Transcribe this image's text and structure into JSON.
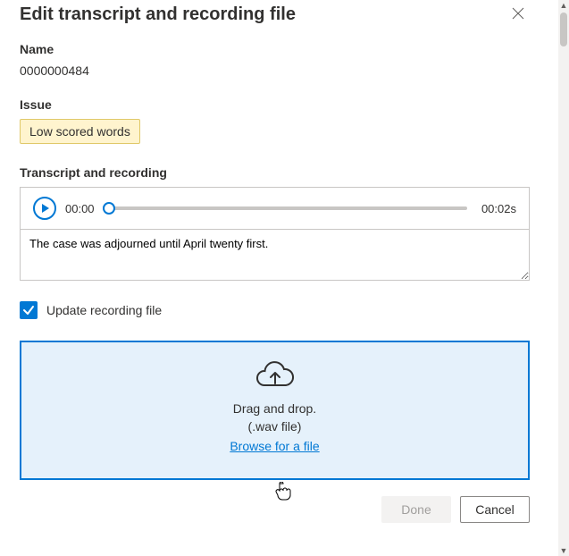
{
  "dialog": {
    "title": "Edit transcript and recording file"
  },
  "name_section": {
    "label": "Name",
    "value": "0000000484"
  },
  "issue_section": {
    "label": "Issue",
    "tag": "Low scored words"
  },
  "player_section": {
    "label": "Transcript and recording",
    "current_time": "00:00",
    "duration": "00:02s",
    "transcript": "The case was adjourned until April twenty first."
  },
  "update_checkbox": {
    "label": "Update recording file",
    "checked": true
  },
  "dropzone": {
    "line1": "Drag and drop.",
    "line2": "(.wav file)",
    "browse": "Browse for a file"
  },
  "footer": {
    "done": "Done",
    "cancel": "Cancel"
  }
}
